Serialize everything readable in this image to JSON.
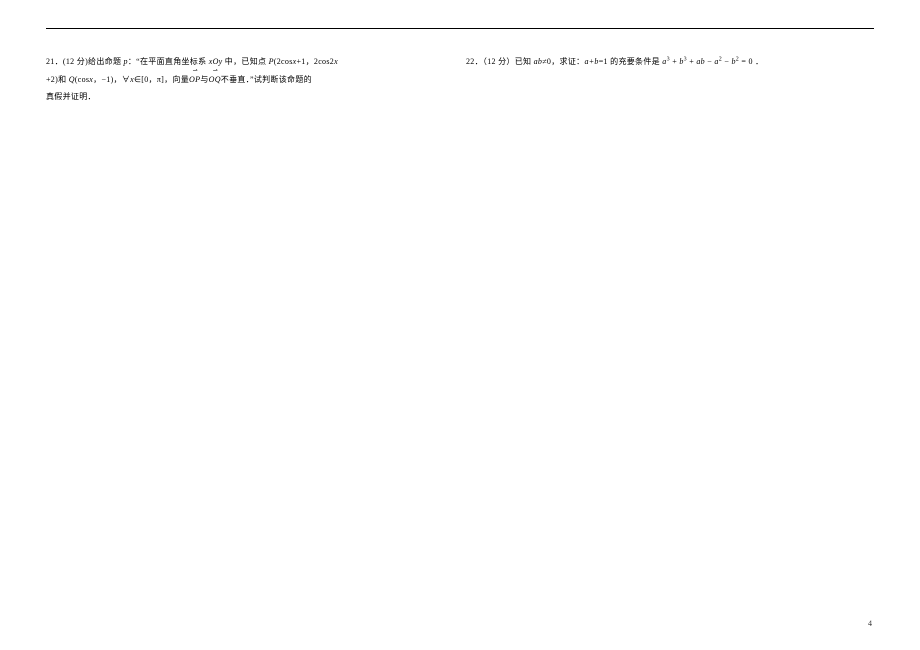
{
  "problem21": {
    "number": "21．",
    "points": "(12 分)",
    "line1_a": "给出命题 ",
    "line1_p": "p",
    "line1_b": "：“在平面直角坐标系 ",
    "line1_xoy": "xOy",
    "line1_c": " 中，已知点 ",
    "line1_pt": "P",
    "line1_d": "(2cos",
    "line1_x1": "x",
    "line1_e": "+1，2cos2",
    "line1_x2": "x",
    "line2_a": "+2)和 ",
    "line2_q": "Q",
    "line2_b": "(cos",
    "line2_x": "x",
    "line2_c": "，−1)，∀",
    "line2_x2": "x",
    "line2_d": "∈[0，π]，向量",
    "line2_vec1": "OP",
    "line2_e": "与",
    "line2_vec2": "OQ",
    "line2_f": "不垂直．”试判断该命题的",
    "line3": "真假并证明．"
  },
  "problem22": {
    "number": "22．",
    "points": "（12 分）",
    "part_a": "已知 ",
    "ab": "ab",
    "part_b": "≠0，求证：",
    "ab_expr": "a+b",
    "part_c": "=1 的充要条件是 ",
    "a": "a",
    "plus1": " + ",
    "b": "b",
    "plus2": " + ",
    "ab2": "ab",
    "minus1": " − ",
    "a2": "a",
    "minus2": " − ",
    "b2": "b",
    "eq": " = 0 ．"
  },
  "pageNumber": "4"
}
